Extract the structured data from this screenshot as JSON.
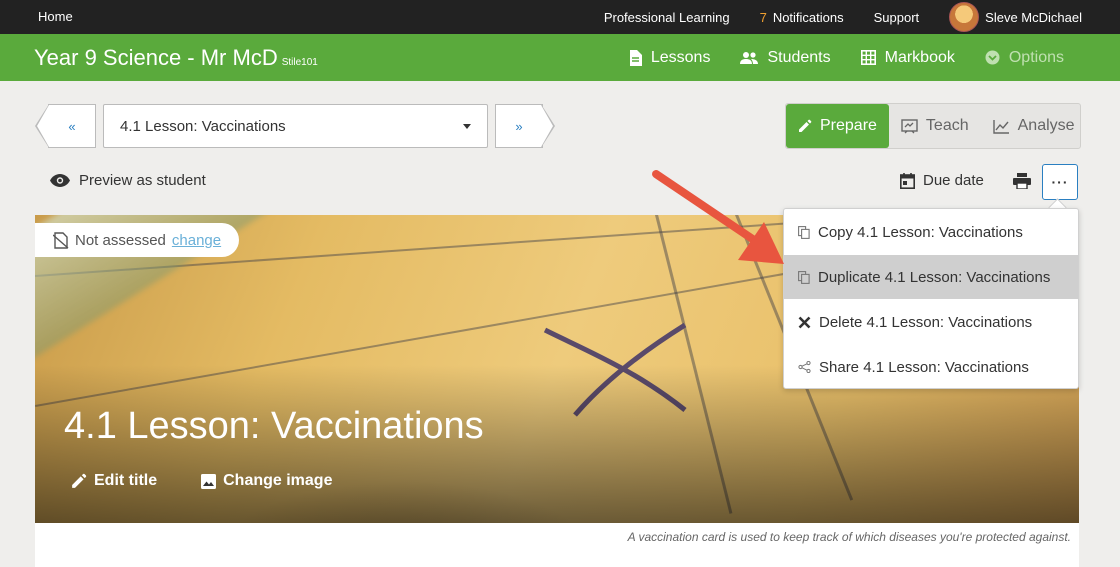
{
  "topbar": {
    "home": "Home",
    "professional_learning": "Professional Learning",
    "notifications_count": "7",
    "notifications_label": "Notifications",
    "support": "Support",
    "user_name": "Sleve McDichael"
  },
  "classbar": {
    "title": "Year 9 Science - Mr McD",
    "code": "Stile101",
    "nav": {
      "lessons": "Lessons",
      "students": "Students",
      "markbook": "Markbook",
      "options": "Options"
    }
  },
  "lesson_nav": {
    "prev": "«",
    "next": "»",
    "selected": "4.1 Lesson: Vaccinations"
  },
  "modes": {
    "prepare": "Prepare",
    "teach": "Teach",
    "analyse": "Analyse"
  },
  "toolbar": {
    "preview": "Preview as student",
    "due_date": "Due date",
    "more": "···"
  },
  "menu": {
    "copy": "Copy 4.1 Lesson: Vaccinations",
    "duplicate": "Duplicate 4.1 Lesson: Vaccinations",
    "delete": "Delete 4.1 Lesson: Vaccinations",
    "share": "Share 4.1 Lesson: Vaccinations"
  },
  "hero": {
    "assessment": "Not assessed",
    "change": "change",
    "title": "4.1 Lesson: Vaccinations",
    "edit_title": "Edit title",
    "change_image": "Change image",
    "caption": "A vaccination card is used to keep track of which diseases you're protected against."
  },
  "colors": {
    "brand_green": "#5aaa3c",
    "topbar": "#222222",
    "link_blue": "#2a7fc1",
    "annotation_arrow": "#e8553f"
  }
}
